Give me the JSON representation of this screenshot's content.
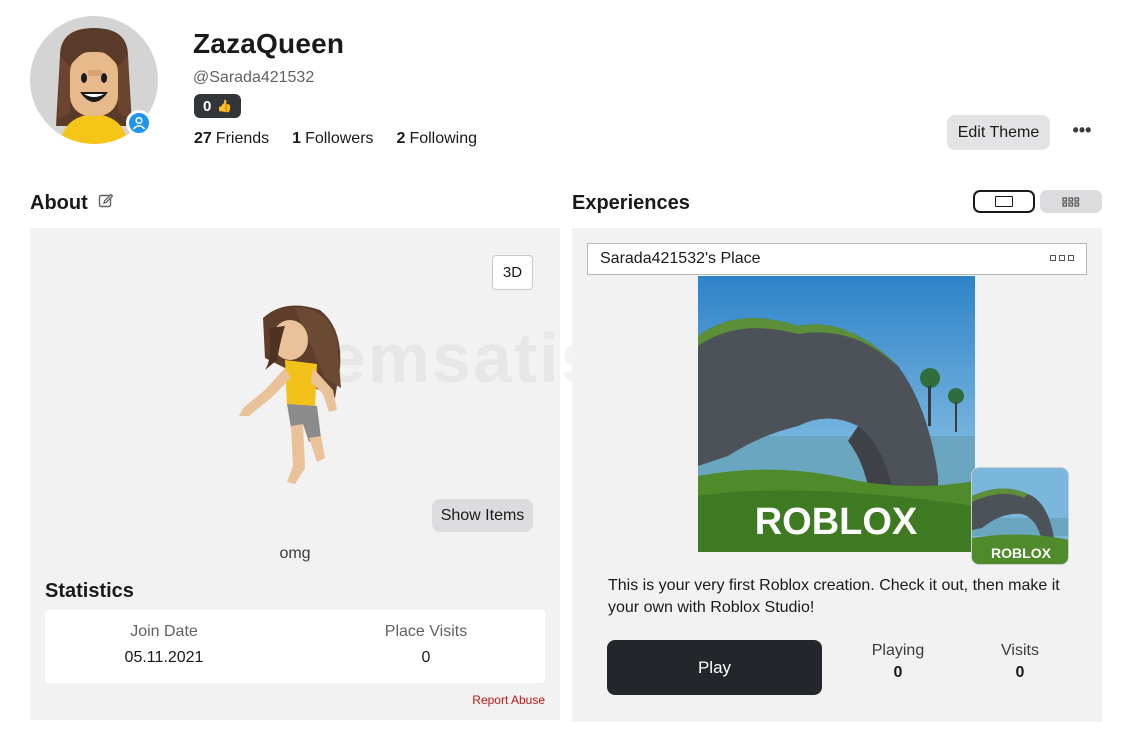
{
  "profile": {
    "display_name": "ZazaQueen",
    "username": "@Sarada421532",
    "robux_count": "0",
    "friends": {
      "count": "27",
      "label": "Friends"
    },
    "followers": {
      "count": "1",
      "label": "Followers"
    },
    "following": {
      "count": "2",
      "label": "Following"
    },
    "edit_theme_label": "Edit Theme",
    "more_label": "•••"
  },
  "about": {
    "title": "About",
    "btn_3d": "3D",
    "show_items_label": "Show Items",
    "bio": "omg",
    "watermark": "itemsatis",
    "statistics_title": "Statistics",
    "join_date_label": "Join Date",
    "join_date_value": "05.11.2021",
    "place_visits_label": "Place Visits",
    "place_visits_value": "0",
    "report_label": "Report Abuse"
  },
  "experiences": {
    "title": "Experiences",
    "place_name": "Sarada421532's Place",
    "thumbnail_text": "ROBLOX",
    "mini_thumbnail_text": "ROBLOX",
    "description": "This is your very first Roblox creation. Check it out, then make it your own with Roblox Studio!",
    "play_label": "Play",
    "playing_label": "Playing",
    "playing_value": "0",
    "visits_label": "Visits",
    "visits_value": "0"
  },
  "colors": {
    "accent_online": "#1e96f0",
    "play_button": "#23262a",
    "report_red": "#c01616",
    "panel_bg": "#f2f2f3"
  }
}
